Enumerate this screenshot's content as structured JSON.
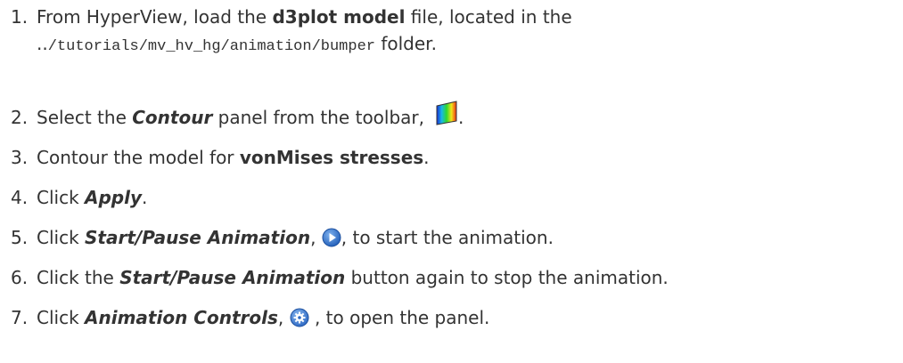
{
  "steps": [
    {
      "num": "1.",
      "t1": "From HyperView, load the ",
      "b1": "d3plot model",
      "t2": " file, located in the",
      "t3": "..",
      "path": "/tutorials/mv_hv_hg/animation/bumper",
      "t4": " folder."
    },
    {
      "num": "2.",
      "t1": "Select the ",
      "bi1": "Contour",
      "t2": " panel from the toolbar,",
      "t3": "."
    },
    {
      "num": "3.",
      "t1": "Contour the model for ",
      "b1": "vonMises stresses",
      "t2": "."
    },
    {
      "num": "4.",
      "t1": "Click ",
      "bi1": "Apply",
      "t2": "."
    },
    {
      "num": "5.",
      "t1": "Click ",
      "bi1": "Start/Pause Animation",
      "t2": ", ",
      "t3": ", to start the animation."
    },
    {
      "num": "6.",
      "t1": "Click the ",
      "bi1": "Start/Pause Animation",
      "t2": " button again to stop the animation."
    },
    {
      "num": "7.",
      "t1": "Click ",
      "bi1": "Animation Controls",
      "t2": ", ",
      "t3": " , to open the panel."
    }
  ],
  "icons": {
    "contour": "contour-rainbow-icon",
    "play": "play-icon",
    "settings": "gear-icon"
  },
  "colors": {
    "text": "#333333",
    "play_icon": "#2f6fc9",
    "gear_icon": "#3a78cf"
  }
}
